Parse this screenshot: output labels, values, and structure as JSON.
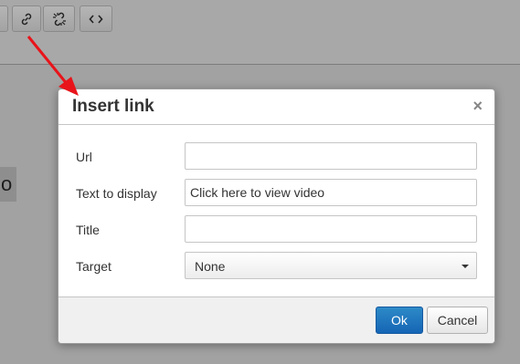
{
  "toolbar": {
    "buttons": [
      {
        "icon": "link-icon"
      },
      {
        "icon": "unlink-icon"
      },
      {
        "icon": "code-icon"
      }
    ]
  },
  "editor": {
    "visible_text": "o"
  },
  "dialog": {
    "title": "Insert link",
    "close_symbol": "×",
    "fields": {
      "url": {
        "label": "Url",
        "value": ""
      },
      "text": {
        "label": "Text to display",
        "value": "Click here to view video"
      },
      "title": {
        "label": "Title",
        "value": ""
      },
      "target": {
        "label": "Target",
        "value": "None"
      }
    },
    "ok_label": "Ok",
    "cancel_label": "Cancel"
  },
  "colors": {
    "annotation_arrow": "#e8141a",
    "ok_button": "#1a6fbf"
  }
}
